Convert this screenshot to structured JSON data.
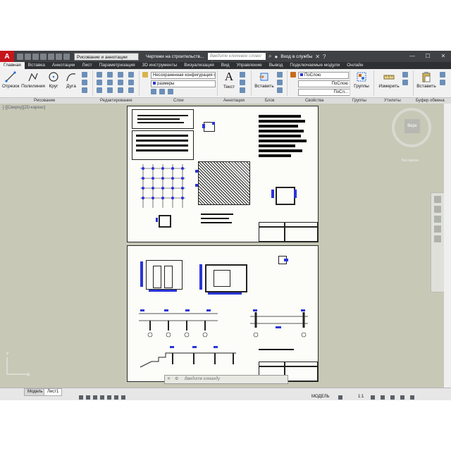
{
  "window": {
    "logo": "A",
    "workspace": "Рисование и аннотации",
    "document_title": "Чертежи на строительств...",
    "search_placeholder": "Введите ключевое слово/фразу",
    "sign_in": "Вход в службы"
  },
  "menu_tabs": [
    "Главная",
    "Вставка",
    "Аннотации",
    "Лист",
    "Параметризация",
    "3D инструменты",
    "Визуализация",
    "Вид",
    "Управление",
    "Вывод",
    "Подключаемые модули",
    "Онлайн"
  ],
  "ribbon": {
    "draw": {
      "line": "Отрезок",
      "polyline": "Полилиния",
      "circle": "Круг",
      "arc": "Дуга",
      "panel": "Рисование"
    },
    "modify": {
      "panel": "Редактирование"
    },
    "layers": {
      "state": "Несохраненная конфигурация сло",
      "layer": "размеры",
      "panel": "Слои"
    },
    "annotation": {
      "text": "Текст",
      "panel": "Аннотации"
    },
    "block": {
      "insert": "Вставить",
      "panel": "Блок"
    },
    "properties": {
      "color": "ПоСлою",
      "linetype": "ПоСлою",
      "lineweight": "ПоСл...",
      "panel": "Свойства"
    },
    "groups": {
      "label": "Группы",
      "panel": "Группы"
    },
    "utilities": {
      "measure": "Измерить",
      "panel": "Утилиты"
    },
    "clipboard": {
      "paste": "Вставить",
      "panel": "Буфер обмена"
    }
  },
  "viewport": {
    "label": "[-][Сверху][2D-каркас]",
    "viewcube_face": "Верх",
    "ucs_label": "Без имени",
    "axis_x": "X",
    "axis_y": "Y"
  },
  "command_line": {
    "placeholder": "Введите команду"
  },
  "status": {
    "layout_tabs": [
      "Модель",
      "Лист1"
    ],
    "active_tab": "Лист1",
    "mode": "МОДЕЛЬ",
    "scale": "1:1"
  },
  "colors": {
    "canvas": "#c7c8b6",
    "title_bar": "#3f4145",
    "accent_red": "#c4161c",
    "dimension_blue": "#2a34d8"
  }
}
